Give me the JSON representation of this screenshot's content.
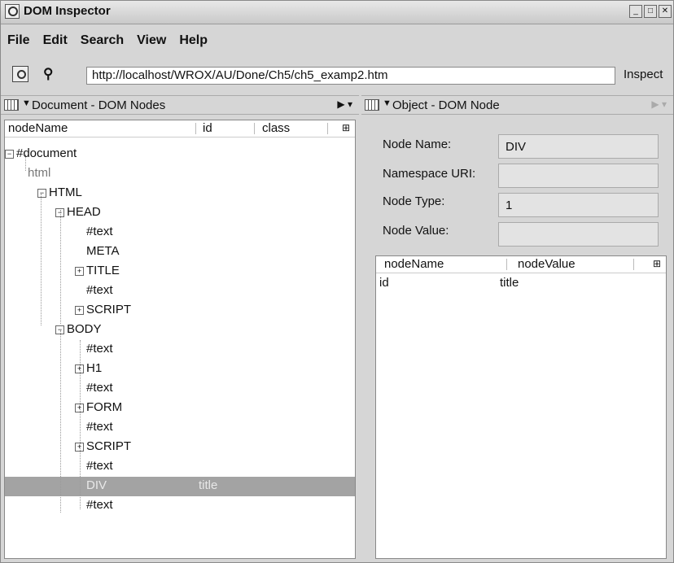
{
  "window": {
    "title": "DOM Inspector"
  },
  "menu": [
    "File",
    "Edit",
    "Search",
    "View",
    "Help"
  ],
  "toolbar": {
    "url": "http://localhost/WROX/AU/Done/Ch5/ch5_examp2.htm",
    "inspect_label": "Inspect"
  },
  "left_pane": {
    "title": "Document - DOM Nodes",
    "columns": [
      "nodeName",
      "id",
      "class"
    ],
    "nodes": [
      "#document",
      "html",
      "HTML",
      "HEAD",
      "#text",
      "META",
      "TITLE",
      "#text",
      "SCRIPT",
      "BODY",
      "#text",
      "H1",
      "#text",
      "FORM",
      "#text",
      "SCRIPT",
      "#text",
      "DIV",
      "#text"
    ],
    "selected": {
      "name": "DIV",
      "id": "title"
    }
  },
  "right_pane": {
    "title": "Object - DOM Node",
    "fields": [
      {
        "label": "Node Name:",
        "value": "DIV"
      },
      {
        "label": "Namespace URI:",
        "value": ""
      },
      {
        "label": "Node Type:",
        "value": "1"
      },
      {
        "label": "Node Value:",
        "value": ""
      }
    ],
    "attr_columns": [
      "nodeName",
      "nodeValue"
    ],
    "attrs": [
      {
        "name": "id",
        "value": "title"
      }
    ]
  }
}
